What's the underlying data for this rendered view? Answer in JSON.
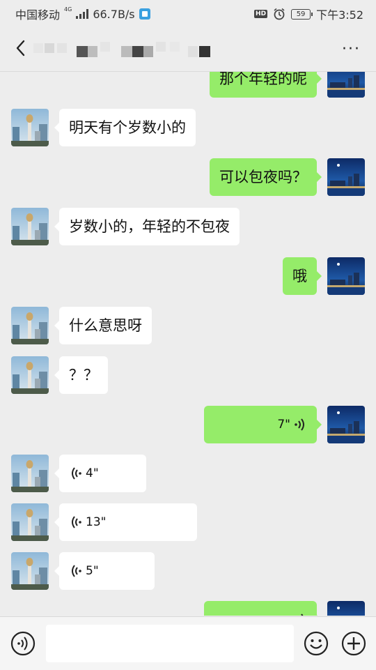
{
  "status_bar": {
    "carrier": "中国移动",
    "network": "4G",
    "speed": "66.7B/s",
    "hd_label": "HD",
    "battery": "59",
    "time": "下午3:52"
  },
  "header": {
    "back_icon": "chevron-left-icon",
    "more_icon": "more-dots-icon",
    "more_label": "···",
    "title_obscured": true
  },
  "messages": [
    {
      "side": "out",
      "type": "text",
      "text": "那个年轻的呢"
    },
    {
      "side": "in",
      "type": "text",
      "text": "明天有个岁数小的"
    },
    {
      "side": "out",
      "type": "text",
      "text": "可以包夜吗？"
    },
    {
      "side": "in",
      "type": "text",
      "text": "岁数小的，年轻的不包夜"
    },
    {
      "side": "out",
      "type": "text",
      "text": "哦"
    },
    {
      "side": "in",
      "type": "text",
      "text": "什么意思呀"
    },
    {
      "side": "in",
      "type": "text",
      "text": "？？"
    },
    {
      "side": "out",
      "type": "voice",
      "duration": "7\""
    },
    {
      "side": "in",
      "type": "voice",
      "duration": "4\""
    },
    {
      "side": "in",
      "type": "voice",
      "duration": "13\""
    },
    {
      "side": "in",
      "type": "voice",
      "duration": "5\""
    },
    {
      "side": "out",
      "type": "voice",
      "duration": ""
    }
  ],
  "input_bar": {
    "voice_icon": "voice-mode-icon",
    "emoji_icon": "emoji-icon",
    "plus_icon": "plus-icon",
    "placeholder": ""
  },
  "colors": {
    "background": "#ededed",
    "outgoing_bubble": "#95ec69",
    "incoming_bubble": "#ffffff"
  }
}
